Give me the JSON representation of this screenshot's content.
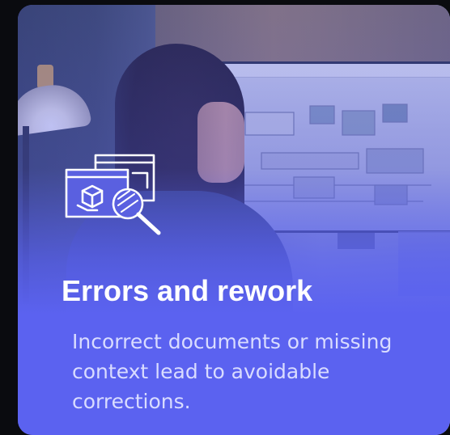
{
  "card": {
    "title": "Errors and rework",
    "description": "Incorrect documents or missing context lead to avoidable corrections.",
    "icon": "documents-magnifier-icon",
    "image": "woman-at-monitor-factory-model-photo"
  },
  "colors": {
    "page_background": "#0a0b0f",
    "card_accent": "#5b62f0",
    "title_text": "#ffffff",
    "description_text": "#d9dcff"
  }
}
